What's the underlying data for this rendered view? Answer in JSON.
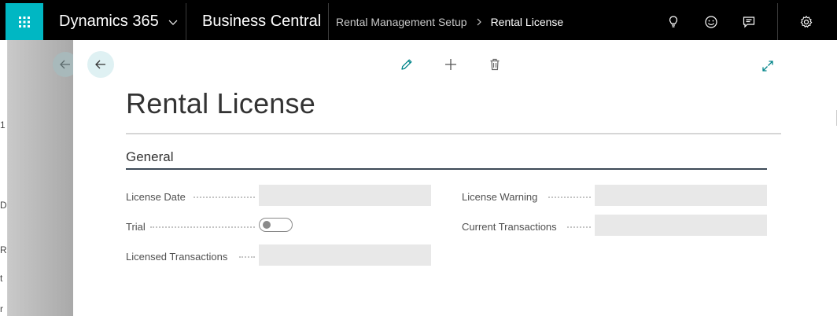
{
  "topbar": {
    "app_name": "Dynamics 365",
    "product_name": "Business Central",
    "breadcrumb_parent": "Rental Management Setup",
    "breadcrumb_current": "Rental License"
  },
  "page": {
    "title": "Rental License",
    "section_title": "General"
  },
  "fields": {
    "license_date": {
      "label": "License Date",
      "value": ""
    },
    "trial": {
      "label": "Trial",
      "value": false
    },
    "licensed_transactions": {
      "label": "Licensed Transactions",
      "value": ""
    },
    "license_warning": {
      "label": "License Warning",
      "value": ""
    },
    "current_transactions": {
      "label": "Current Transactions",
      "value": ""
    }
  },
  "background": {
    "edge_letters": [
      "1",
      "D",
      "R",
      "t",
      "r"
    ]
  },
  "colors": {
    "accent": "#00b7c3",
    "topbar": "#000000",
    "field_bg": "#e8e8e8",
    "back_button_bg": "#dff1f3"
  },
  "icons": {
    "waffle": "app-launcher-icon",
    "lightbulb": "lightbulb-icon",
    "smile": "smile-icon",
    "chat": "chat-icon",
    "settings": "gear-icon",
    "edit": "pencil-icon",
    "add": "plus-icon",
    "delete": "trash-icon",
    "expand": "expand-icon",
    "back": "arrow-left-icon"
  }
}
